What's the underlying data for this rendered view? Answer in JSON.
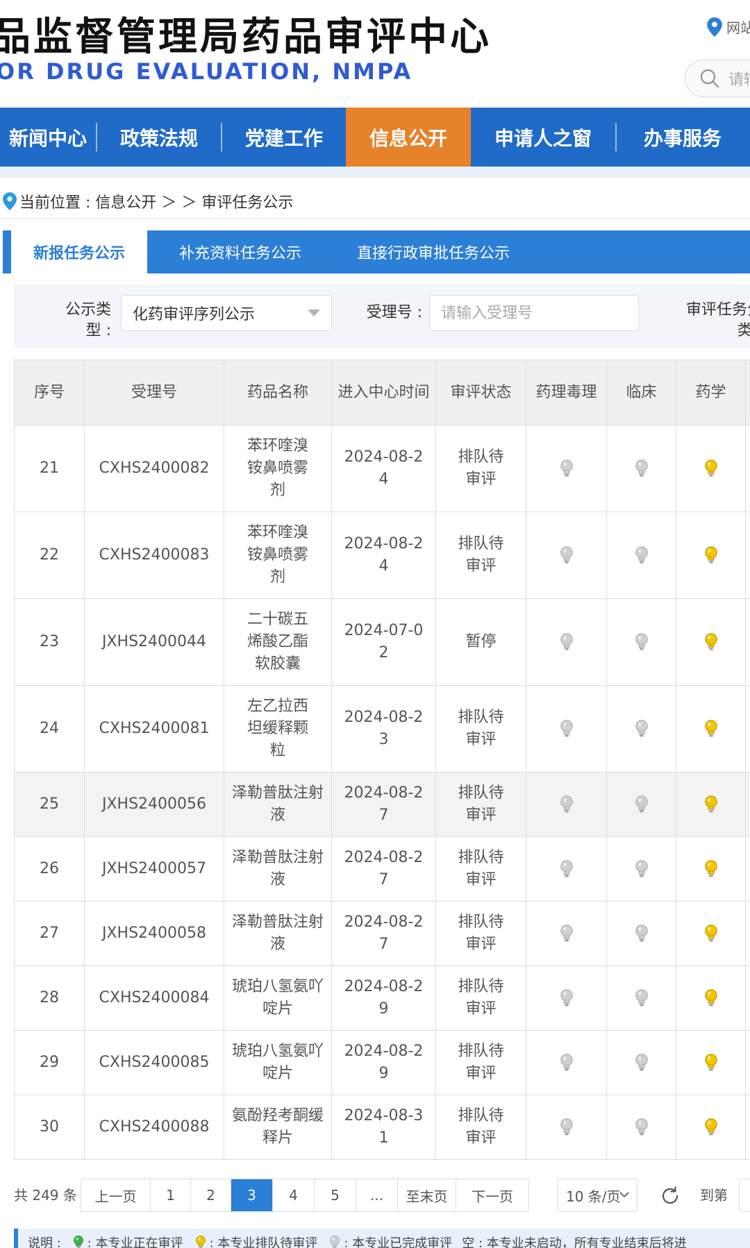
{
  "header": {
    "title_cn": "品监督管理局药品审评中心",
    "title_en": "OR DRUG EVALUATION, NMPA",
    "site_link": "网站",
    "search_placeholder": "请输"
  },
  "nav": {
    "items": [
      "新闻中心",
      "政策法规",
      "党建工作",
      "信息公开",
      "申请人之窗",
      "办事服务"
    ],
    "active_index": 3
  },
  "breadcrumb": {
    "text": "当前位置 : 信息公开 ＞ ＞ 审评任务公示"
  },
  "tabs": {
    "items": [
      "新报任务公示",
      "补充资料任务公示",
      "直接行政审批任务公示"
    ],
    "active_index": 0
  },
  "filter": {
    "type_label_line1": "公示类",
    "type_label_line2": "型 :",
    "type_value": "化药审评序列公示",
    "accept_label": "受理号 :",
    "accept_placeholder": "请输入受理号",
    "task_label_line1": "审评任务分",
    "task_label_line2": "类 :"
  },
  "table": {
    "headers": [
      "序号",
      "受理号",
      "药品名称",
      "进入中心时间",
      "审评状态",
      "药理毒理",
      "临床",
      "药学"
    ],
    "rows": [
      {
        "no": "21",
        "id": "CXHS2400082",
        "name": "苯环喹溴铵鼻喷雾剂",
        "date": "2024-08-24",
        "status": "排队待审评",
        "tox": "off",
        "clin": "off",
        "pharm": "queue"
      },
      {
        "no": "22",
        "id": "CXHS2400083",
        "name": "苯环喹溴铵鼻喷雾剂",
        "date": "2024-08-24",
        "status": "排队待审评",
        "tox": "off",
        "clin": "off",
        "pharm": "queue"
      },
      {
        "no": "23",
        "id": "JXHS2400044",
        "name": "二十碳五烯酸乙酯软胶囊",
        "date": "2024-07-02",
        "status": "暂停",
        "tox": "off",
        "clin": "off",
        "pharm": "queue"
      },
      {
        "no": "24",
        "id": "CXHS2400081",
        "name": "左乙拉西坦缓释颗粒",
        "date": "2024-08-23",
        "status": "排队待审评",
        "tox": "off",
        "clin": "off",
        "pharm": "queue"
      },
      {
        "no": "25",
        "id": "JXHS2400056",
        "name": "泽勒普肽注射液",
        "date": "2024-08-27",
        "status": "排队待审评",
        "tox": "off",
        "clin": "off",
        "pharm": "queue"
      },
      {
        "no": "26",
        "id": "JXHS2400057",
        "name": "泽勒普肽注射液",
        "date": "2024-08-27",
        "status": "排队待审评",
        "tox": "off",
        "clin": "off",
        "pharm": "queue"
      },
      {
        "no": "27",
        "id": "JXHS2400058",
        "name": "泽勒普肽注射液",
        "date": "2024-08-27",
        "status": "排队待审评",
        "tox": "off",
        "clin": "off",
        "pharm": "queue"
      },
      {
        "no": "28",
        "id": "CXHS2400084",
        "name": "琥珀八氢氨吖啶片",
        "date": "2024-08-29",
        "status": "排队待审评",
        "tox": "off",
        "clin": "off",
        "pharm": "queue"
      },
      {
        "no": "29",
        "id": "CXHS2400085",
        "name": "琥珀八氢氨吖啶片",
        "date": "2024-08-29",
        "status": "排队待审评",
        "tox": "off",
        "clin": "off",
        "pharm": "queue"
      },
      {
        "no": "30",
        "id": "CXHS2400088",
        "name": "氨酚羟考酮缓释片",
        "date": "2024-08-31",
        "status": "排队待审评",
        "tox": "off",
        "clin": "off",
        "pharm": "queue"
      }
    ]
  },
  "pagination": {
    "total": "共 249 条",
    "prev": "上一页",
    "pages": [
      "1",
      "2",
      "3",
      "4",
      "5",
      "..."
    ],
    "active_page": "3",
    "last": "至末页",
    "next": "下一页",
    "page_size": "10 条/页",
    "goto": "到第"
  },
  "legend": {
    "label": "说明 :",
    "active": ": 本专业正在审评",
    "queue": ": 本专业排队待审评",
    "done": ": 本专业已完成审评",
    "empty": "空 : 本专业未启动，所有专业结束后将进"
  },
  "colors": {
    "nav_bg": "#1f6bc7",
    "nav_active": "#e6822a",
    "tab_bg": "#2c7fd6",
    "title_en": "#2f5bd3",
    "bulb_queue": "#f2c500",
    "bulb_active": "#3db34a",
    "bulb_off": "#d0d0d0"
  }
}
